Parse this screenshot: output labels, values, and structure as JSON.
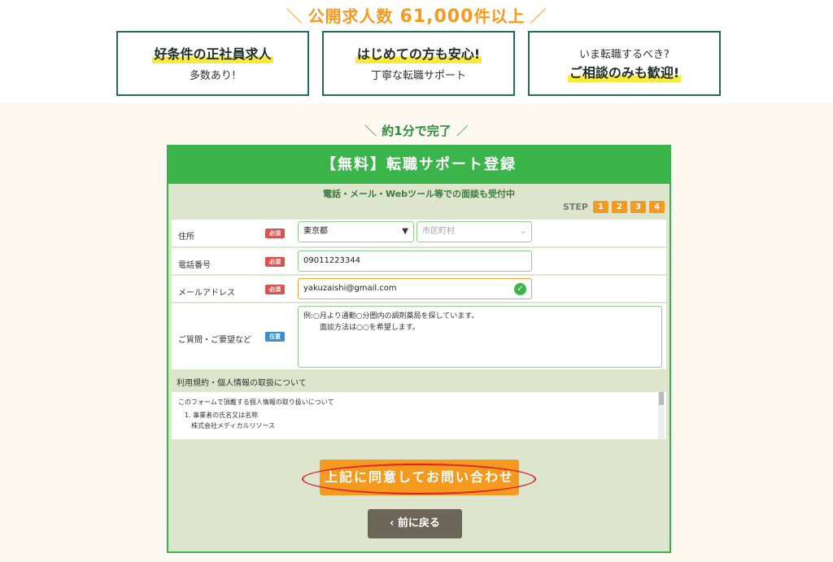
{
  "headline": {
    "slash_left": "＼",
    "prefix": "公開求人数 ",
    "number": "61,000",
    "suffix": "件以上",
    "slash_right": "／"
  },
  "features": [
    {
      "pre": "",
      "main": "好条件の正社員求人",
      "sub": "多数あり!"
    },
    {
      "pre": "",
      "main": "はじめての方も安心!",
      "sub": "丁寧な転職サポート"
    },
    {
      "pre": "いま転職するべき?",
      "main": "ご相談のみも歓迎!",
      "sub": ""
    }
  ],
  "done_label": {
    "slash_left": "＼",
    "text": "約1分で完了",
    "slash_right": "／"
  },
  "form": {
    "title": "【無料】転職サポート登録",
    "note": "電話・メール・Webツール等での面談も受付中",
    "step_label": "STEP",
    "steps": [
      "1",
      "2",
      "3",
      "4"
    ],
    "fields": {
      "address_label": "住所",
      "address_badge": "必須",
      "prefecture_value": "東京都",
      "city_placeholder": "市区町村",
      "phone_label": "電話番号",
      "phone_badge": "必須",
      "phone_value": "09011223344",
      "email_label": "メールアドレス",
      "email_badge": "必須",
      "email_value": "yakuzaishi@gmail.com",
      "questions_label": "ご質問・ご要望など",
      "questions_badge": "任意",
      "questions_line1": "例:○月より通勤○分圏内の調剤薬局を探しています。",
      "questions_line2": "面談方法は○○を希望します。"
    },
    "terms_title": "利用規約・個人情報の取扱について",
    "terms_lines": {
      "l1": "このフォームで頂戴する個人情報の取り扱いについて",
      "l2": "1. 事業者の氏名又は名称",
      "l3": "株式会社メディカルリソース"
    },
    "submit_label": "上記に同意してお問い合わせ",
    "back_label": "‹ 前に戻る"
  },
  "colors": {
    "accent_orange": "#f39a1f",
    "green": "#3bb54a",
    "dark_green": "#1e6e5a",
    "highlight_yellow": "#fbe93a",
    "annotation_red": "#e31e2e"
  }
}
